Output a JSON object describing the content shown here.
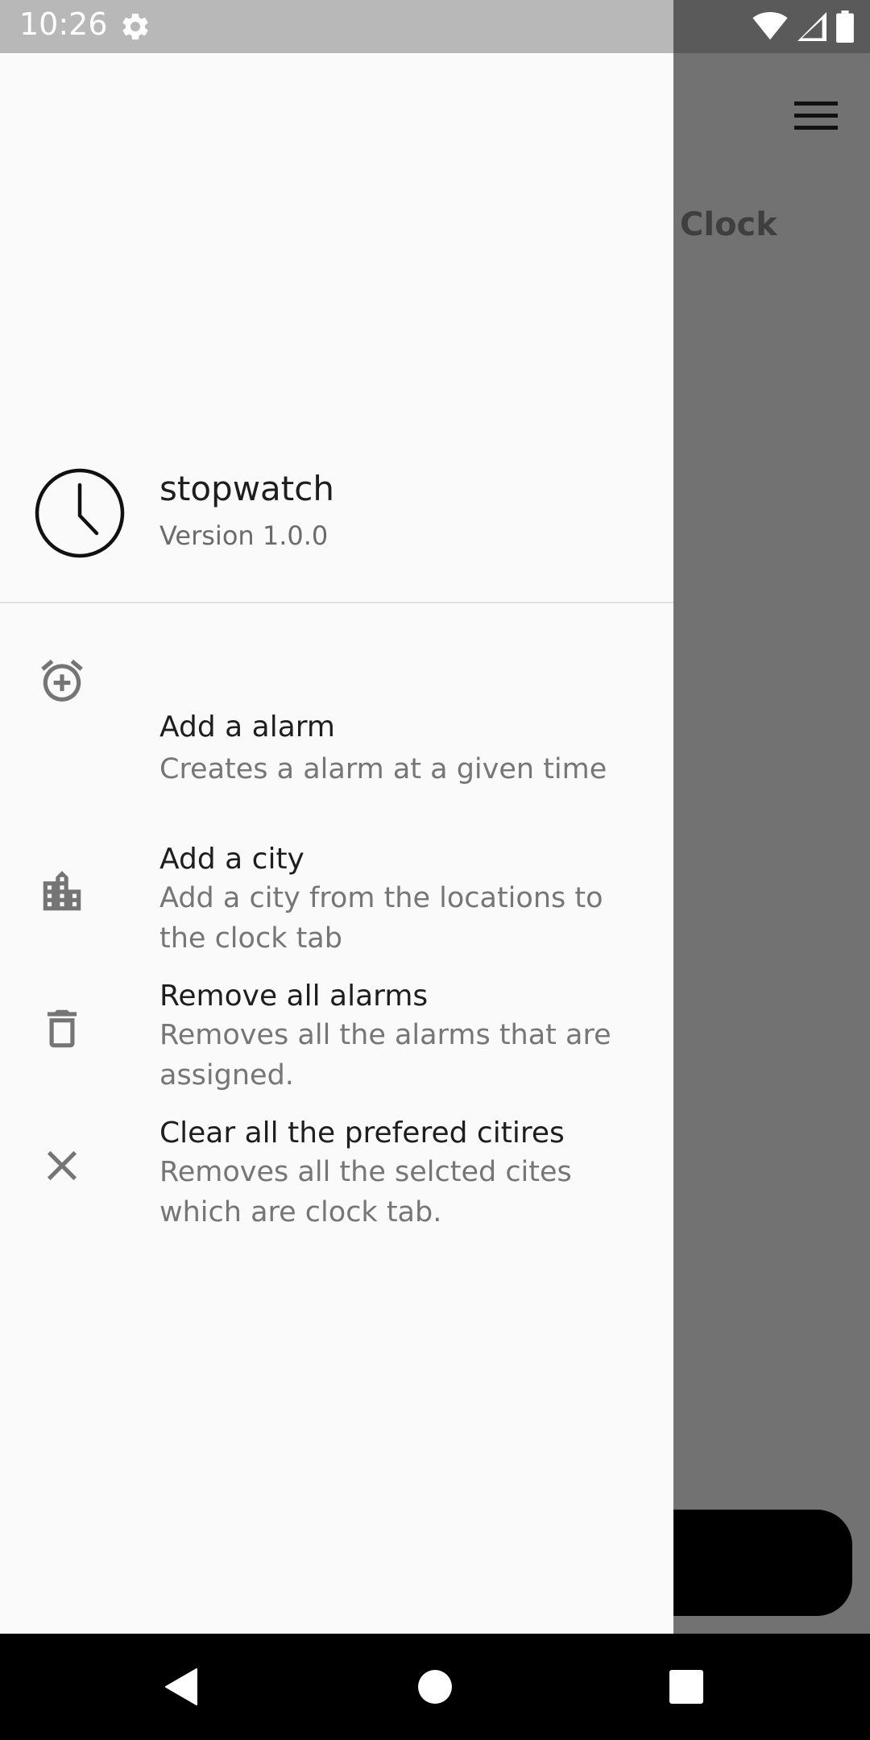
{
  "status_bar": {
    "time": "10:26",
    "icons": [
      "settings-gear-icon",
      "wifi-icon",
      "signal-icon",
      "battery-icon"
    ]
  },
  "background_app": {
    "tab_label": "Clock",
    "menu_icon": "hamburger-menu-icon"
  },
  "drawer": {
    "header": {
      "app_name": "stopwatch",
      "version": "Version 1.0.0",
      "logo_icon": "clock-icon"
    },
    "items": [
      {
        "icon": "alarm-add-icon",
        "title": "Add a alarm",
        "description": "Creates a alarm at a given time"
      },
      {
        "icon": "city-icon",
        "title": "Add a city",
        "description": "Add a city from the locations to the clock tab"
      },
      {
        "icon": "delete-icon",
        "title": "Remove all alarms",
        "description": "Removes all the alarms that are assigned."
      },
      {
        "icon": "close-icon",
        "title": "Clear all the prefered citires",
        "description": "Removes all the selcted cites which are clock tab."
      }
    ]
  },
  "nav_bar": {
    "buttons": [
      "back-icon",
      "home-icon",
      "recents-icon"
    ]
  },
  "colors": {
    "drawer_bg": "#fafafa",
    "scrim": "#727272",
    "status_bar_light": "#b8b8b8",
    "status_bar_dark": "#5a5a5a",
    "primary_text": "#1e1e1e",
    "secondary_text": "#767676",
    "icon_grey": "#757575"
  }
}
